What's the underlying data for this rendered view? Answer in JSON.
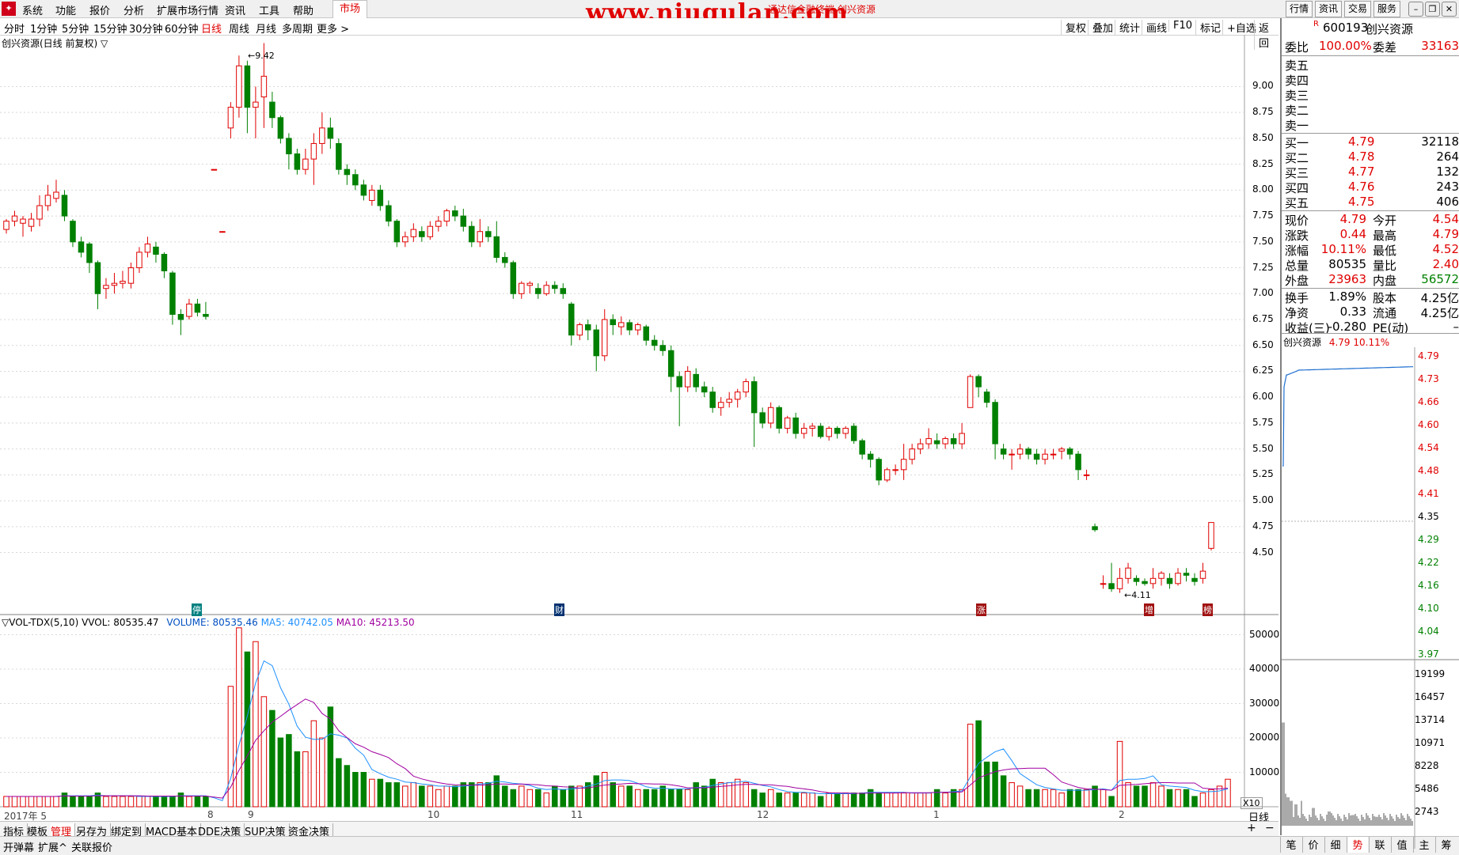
{
  "menu": {
    "items": [
      "系统",
      "功能",
      "报价",
      "分析",
      "扩展市场行情",
      "资讯",
      "工具",
      "帮助"
    ],
    "market": "市场",
    "watermark": "www.niugulan.com",
    "sub_title": "通达信金融终端  创兴资源",
    "right_buttons": [
      "行情",
      "资讯",
      "交易",
      "服务"
    ]
  },
  "periods": [
    "分时",
    "1分钟",
    "5分钟",
    "15分钟",
    "30分钟",
    "60分钟",
    "日线",
    "周线",
    "月线",
    "多周期",
    "更多 >"
  ],
  "active_period": "日线",
  "tools": [
    "复权",
    "叠加",
    "统计",
    "画线",
    "F10",
    "标记",
    "+自选",
    "返回"
  ],
  "chart_title": "创兴资源(日线 前复权) ▽",
  "price_axis": [
    "9.00",
    "8.75",
    "8.50",
    "8.25",
    "8.00",
    "7.75",
    "7.50",
    "7.25",
    "7.00",
    "6.75",
    "6.50",
    "6.25",
    "6.00",
    "5.75",
    "5.50",
    "5.25",
    "5.00",
    "4.75",
    "4.50"
  ],
  "high_marker": "9.42",
  "low_marker": "4.11",
  "event_markers": [
    "停",
    "财",
    "涨",
    "增",
    "榜"
  ],
  "vol_title": {
    "name": "▽VOL-TDX(5,10)",
    "vvol": "VVOL: 80535.47",
    "volume": "VOLUME: 80535.46",
    "ma5": "MA5: 40742.05",
    "ma10": "MA10: 45213.50"
  },
  "vol_axis": [
    "50000",
    "40000",
    "30000",
    "20000",
    "10000"
  ],
  "vol_unit": "X10",
  "date_axis": [
    "2017年 5",
    "8",
    "9",
    "10",
    "11",
    "12",
    "1",
    "2"
  ],
  "bottom_tabs": [
    "指标",
    "模板",
    "管理",
    "另存为",
    "绑定到",
    "MACD基本",
    "DDE决策",
    "SUP决策",
    "资金决策"
  ],
  "status_left": [
    "开弹幕",
    "扩展^",
    "关联报价"
  ],
  "axis_period": "日线",
  "quote": {
    "code_mark": "R",
    "code": "600193",
    "name": "创兴资源",
    "weibi_label": "委比",
    "weibi": "100.00%",
    "weicha_label": "委差",
    "weicha": "33163",
    "sell": [
      {
        "label": "卖五",
        "price": "",
        "vol": ""
      },
      {
        "label": "卖四",
        "price": "",
        "vol": ""
      },
      {
        "label": "卖三",
        "price": "",
        "vol": ""
      },
      {
        "label": "卖二",
        "price": "",
        "vol": ""
      },
      {
        "label": "卖一",
        "price": "",
        "vol": ""
      }
    ],
    "buy": [
      {
        "label": "买一",
        "price": "4.79",
        "vol": "32118"
      },
      {
        "label": "买二",
        "price": "4.78",
        "vol": "264"
      },
      {
        "label": "买三",
        "price": "4.77",
        "vol": "132"
      },
      {
        "label": "买四",
        "price": "4.76",
        "vol": "243"
      },
      {
        "label": "买五",
        "price": "4.75",
        "vol": "406"
      }
    ],
    "stats": [
      {
        "l1": "现价",
        "v1": "4.79",
        "c1": "red",
        "l2": "今开",
        "v2": "4.54",
        "c2": "red"
      },
      {
        "l1": "涨跌",
        "v1": "0.44",
        "c1": "red",
        "l2": "最高",
        "v2": "4.79",
        "c2": "red"
      },
      {
        "l1": "涨幅",
        "v1": "10.11%",
        "c1": "red",
        "l2": "最低",
        "v2": "4.52",
        "c2": "red"
      },
      {
        "l1": "总量",
        "v1": "80535",
        "c1": "black",
        "l2": "量比",
        "v2": "2.40",
        "c2": "red"
      },
      {
        "l1": "外盘",
        "v1": "23963",
        "c1": "red",
        "l2": "内盘",
        "v2": "56572",
        "c2": "green"
      }
    ],
    "stats2": [
      {
        "l1": "换手",
        "v1": "1.89%",
        "l2": "股本",
        "v2": "4.25亿"
      },
      {
        "l1": "净资",
        "v1": "0.33",
        "l2": "流通",
        "v2": "4.25亿"
      },
      {
        "l1": "收益(三)",
        "v1": "-0.280",
        "l2": "PE(动)",
        "v2": "–"
      }
    ],
    "mini_title": "创兴资源",
    "mini_price": "4.79",
    "mini_pct": "10.11%",
    "mini_axis": [
      "4.79",
      "4.73",
      "4.66",
      "4.60",
      "4.54",
      "4.48",
      "4.41",
      "4.35",
      "4.29",
      "4.22",
      "4.16",
      "4.10",
      "4.04",
      "3.97"
    ],
    "mini_vol_axis": [
      "19199",
      "16457",
      "13714",
      "10971",
      "8228",
      "5486",
      "2743"
    ],
    "right_tabs": [
      "笔",
      "价",
      "细",
      "势",
      "联",
      "值",
      "主",
      "筹"
    ]
  },
  "chart_data": {
    "type": "candlestick",
    "ylim": [
      4.0,
      9.5
    ],
    "candles": [
      [
        7.62,
        7.7,
        7.72,
        7.58
      ],
      [
        7.7,
        7.75,
        7.8,
        7.65
      ],
      [
        7.68,
        7.72,
        7.75,
        7.55
      ],
      [
        7.65,
        7.72,
        7.78,
        7.6
      ],
      [
        7.72,
        7.85,
        7.95,
        7.65
      ],
      [
        7.85,
        7.95,
        8.05,
        7.8
      ],
      [
        7.92,
        7.98,
        8.1,
        7.88
      ],
      [
        7.95,
        7.75,
        8.0,
        7.7
      ],
      [
        7.7,
        7.5,
        7.72,
        7.45
      ],
      [
        7.5,
        7.4,
        7.55,
        7.35
      ],
      [
        7.48,
        7.3,
        7.5,
        7.2
      ],
      [
        7.3,
        7.0,
        7.32,
        6.85
      ],
      [
        7.05,
        7.08,
        7.15,
        6.95
      ],
      [
        7.08,
        7.1,
        7.2,
        7.0
      ],
      [
        7.1,
        7.12,
        7.22,
        7.05
      ],
      [
        7.1,
        7.25,
        7.3,
        7.05
      ],
      [
        7.25,
        7.4,
        7.45,
        7.2
      ],
      [
        7.4,
        7.48,
        7.55,
        7.35
      ],
      [
        7.45,
        7.38,
        7.5,
        7.3
      ],
      [
        7.38,
        7.22,
        7.4,
        7.15
      ],
      [
        7.2,
        6.8,
        7.22,
        6.7
      ],
      [
        6.8,
        6.75,
        6.85,
        6.6
      ],
      [
        6.78,
        6.9,
        6.95,
        6.75
      ],
      [
        6.9,
        6.82,
        6.95,
        6.78
      ],
      [
        6.8,
        6.78,
        6.92,
        6.75
      ],
      [
        8.2,
        8.2,
        8.2,
        8.2
      ],
      [
        7.6,
        7.6,
        7.6,
        7.6
      ],
      [
        8.6,
        8.8,
        8.85,
        8.5
      ],
      [
        8.8,
        9.2,
        9.3,
        8.7
      ],
      [
        9.2,
        8.8,
        9.25,
        8.55
      ],
      [
        8.8,
        8.85,
        9.0,
        8.5
      ],
      [
        8.9,
        9.1,
        9.42,
        8.6
      ],
      [
        8.85,
        8.7,
        8.95,
        8.6
      ],
      [
        8.7,
        8.5,
        8.72,
        8.45
      ],
      [
        8.5,
        8.35,
        8.55,
        8.2
      ],
      [
        8.35,
        8.2,
        8.4,
        8.15
      ],
      [
        8.2,
        8.3,
        8.4,
        8.15
      ],
      [
        8.3,
        8.45,
        8.55,
        8.05
      ],
      [
        8.45,
        8.6,
        8.75,
        8.35
      ],
      [
        8.6,
        8.5,
        8.7,
        8.4
      ],
      [
        8.45,
        8.2,
        8.5,
        8.15
      ],
      [
        8.2,
        8.15,
        8.25,
        8.05
      ],
      [
        8.15,
        8.05,
        8.2,
        8.0
      ],
      [
        8.05,
        7.95,
        8.1,
        7.9
      ],
      [
        7.9,
        8.0,
        8.05,
        7.85
      ],
      [
        8.0,
        7.85,
        8.05,
        7.8
      ],
      [
        7.85,
        7.7,
        7.9,
        7.65
      ],
      [
        7.7,
        7.5,
        7.72,
        7.45
      ],
      [
        7.5,
        7.55,
        7.6,
        7.45
      ],
      [
        7.55,
        7.62,
        7.68,
        7.5
      ],
      [
        7.6,
        7.55,
        7.65,
        7.5
      ],
      [
        7.55,
        7.65,
        7.7,
        7.52
      ],
      [
        7.65,
        7.7,
        7.75,
        7.6
      ],
      [
        7.7,
        7.8,
        7.82,
        7.65
      ],
      [
        7.8,
        7.75,
        7.85,
        7.7
      ],
      [
        7.75,
        7.65,
        7.82,
        7.6
      ],
      [
        7.65,
        7.5,
        7.7,
        7.45
      ],
      [
        7.5,
        7.6,
        7.72,
        7.45
      ],
      [
        7.6,
        7.55,
        7.65,
        7.5
      ],
      [
        7.55,
        7.35,
        7.7,
        7.3
      ],
      [
        7.35,
        7.3,
        7.4,
        7.25
      ],
      [
        7.3,
        7.0,
        7.32,
        6.95
      ],
      [
        7.0,
        7.1,
        7.12,
        6.95
      ],
      [
        7.08,
        7.1,
        7.12,
        7.0
      ],
      [
        7.05,
        7.0,
        7.1,
        6.95
      ],
      [
        7.0,
        7.08,
        7.12,
        6.98
      ],
      [
        7.08,
        7.05,
        7.12,
        7.0
      ],
      [
        7.05,
        7.0,
        7.1,
        6.95
      ],
      [
        6.9,
        6.6,
        6.92,
        6.5
      ],
      [
        6.6,
        6.7,
        6.72,
        6.55
      ],
      [
        6.7,
        6.65,
        6.75,
        6.55
      ],
      [
        6.65,
        6.4,
        6.7,
        6.25
      ],
      [
        6.4,
        6.75,
        6.85,
        6.35
      ],
      [
        6.75,
        6.7,
        6.8,
        6.6
      ],
      [
        6.68,
        6.72,
        6.78,
        6.6
      ],
      [
        6.72,
        6.65,
        6.75,
        6.6
      ],
      [
        6.65,
        6.7,
        6.72,
        6.6
      ],
      [
        6.68,
        6.55,
        6.7,
        6.5
      ],
      [
        6.55,
        6.5,
        6.6,
        6.45
      ],
      [
        6.5,
        6.45,
        6.55,
        6.4
      ],
      [
        6.45,
        6.2,
        6.5,
        6.05
      ],
      [
        6.2,
        6.1,
        6.25,
        5.72
      ],
      [
        6.1,
        6.25,
        6.3,
        6.05
      ],
      [
        6.22,
        6.1,
        6.28,
        6.05
      ],
      [
        6.1,
        6.05,
        6.15,
        6.0
      ],
      [
        6.05,
        5.9,
        6.1,
        5.85
      ],
      [
        5.9,
        5.95,
        6.0,
        5.82
      ],
      [
        5.95,
        5.98,
        6.05,
        5.9
      ],
      [
        5.98,
        6.05,
        6.08,
        5.9
      ],
      [
        6.05,
        6.15,
        6.18,
        6.0
      ],
      [
        6.15,
        5.85,
        6.2,
        5.52
      ],
      [
        5.85,
        5.75,
        5.9,
        5.7
      ],
      [
        5.75,
        5.9,
        5.95,
        5.7
      ],
      [
        5.9,
        5.7,
        5.92,
        5.65
      ],
      [
        5.7,
        5.8,
        5.82,
        5.65
      ],
      [
        5.8,
        5.65,
        5.85,
        5.6
      ],
      [
        5.65,
        5.7,
        5.75,
        5.6
      ],
      [
        5.7,
        5.72,
        5.75,
        5.62
      ],
      [
        5.72,
        5.62,
        5.75,
        5.6
      ],
      [
        5.62,
        5.7,
        5.72,
        5.58
      ],
      [
        5.7,
        5.65,
        5.72,
        5.6
      ],
      [
        5.65,
        5.7,
        5.72,
        5.6
      ],
      [
        5.72,
        5.58,
        5.75,
        5.55
      ],
      [
        5.58,
        5.45,
        5.6,
        5.4
      ],
      [
        5.45,
        5.4,
        5.48,
        5.32
      ],
      [
        5.4,
        5.2,
        5.42,
        5.15
      ],
      [
        5.2,
        5.3,
        5.32,
        5.18
      ],
      [
        5.3,
        5.3,
        5.35,
        5.25
      ],
      [
        5.3,
        5.4,
        5.55,
        5.2
      ],
      [
        5.4,
        5.5,
        5.55,
        5.35
      ],
      [
        5.5,
        5.55,
        5.6,
        5.45
      ],
      [
        5.55,
        5.6,
        5.7,
        5.5
      ],
      [
        5.58,
        5.55,
        5.65,
        5.5
      ],
      [
        5.55,
        5.6,
        5.62,
        5.5
      ],
      [
        5.6,
        5.55,
        5.65,
        5.5
      ],
      [
        5.55,
        5.65,
        5.75,
        5.5
      ],
      [
        5.9,
        6.2,
        6.22,
        5.9
      ],
      [
        6.2,
        6.1,
        6.22,
        6.0
      ],
      [
        6.05,
        5.95,
        6.08,
        5.9
      ],
      [
        5.95,
        5.55,
        5.98,
        5.4
      ],
      [
        5.5,
        5.45,
        5.55,
        5.4
      ],
      [
        5.45,
        5.45,
        5.5,
        5.3
      ],
      [
        5.45,
        5.5,
        5.55,
        5.4
      ],
      [
        5.5,
        5.45,
        5.52,
        5.4
      ],
      [
        5.45,
        5.4,
        5.5,
        5.35
      ],
      [
        5.4,
        5.45,
        5.5,
        5.35
      ],
      [
        5.45,
        5.45,
        5.5,
        5.4
      ],
      [
        5.48,
        5.5,
        5.52,
        5.4
      ],
      [
        5.5,
        5.45,
        5.52,
        5.4
      ],
      [
        5.45,
        5.3,
        5.48,
        5.2
      ],
      [
        5.25,
        5.25,
        5.3,
        5.2
      ],
      [
        4.75,
        4.72,
        4.78,
        4.7
      ],
      [
        4.2,
        4.2,
        4.28,
        4.15
      ],
      [
        4.2,
        4.15,
        4.4,
        4.12
      ],
      [
        4.15,
        4.25,
        4.35,
        4.11
      ],
      [
        4.25,
        4.35,
        4.4,
        4.2
      ],
      [
        4.25,
        4.22,
        4.28,
        4.18
      ],
      [
        4.22,
        4.2,
        4.25,
        4.18
      ],
      [
        4.2,
        4.25,
        4.35,
        4.15
      ],
      [
        4.25,
        4.3,
        4.32,
        4.18
      ],
      [
        4.25,
        4.2,
        4.3,
        4.15
      ],
      [
        4.2,
        4.3,
        4.35,
        4.18
      ],
      [
        4.3,
        4.28,
        4.35,
        4.22
      ],
      [
        4.25,
        4.22,
        4.3,
        4.18
      ],
      [
        4.25,
        4.32,
        4.4,
        4.2
      ],
      [
        4.54,
        4.79,
        4.79,
        4.52
      ]
    ],
    "volume": [
      3,
      3,
      3,
      3,
      3,
      3,
      3,
      4,
      3,
      3,
      3,
      4,
      3,
      3,
      3,
      3,
      3,
      3,
      3,
      3,
      3,
      4,
      3,
      3,
      3,
      0,
      0,
      35,
      52,
      45,
      48,
      32,
      28,
      20,
      21,
      16,
      16,
      25,
      20,
      29,
      14,
      12,
      10,
      10,
      8,
      8,
      7,
      7,
      6,
      7,
      6,
      6,
      5,
      6,
      6,
      7,
      7,
      7,
      7,
      9,
      6,
      5,
      6,
      5,
      5,
      4,
      6,
      5,
      6,
      6,
      7,
      9,
      10,
      7,
      6,
      6,
      5,
      5,
      5,
      6,
      5,
      5,
      5,
      7,
      6,
      8,
      7,
      7,
      8,
      7,
      5,
      4,
      5,
      4,
      4,
      4,
      4,
      4,
      3,
      4,
      4,
      4,
      4,
      4,
      5,
      4,
      4,
      4,
      4,
      4,
      4,
      4,
      5,
      4,
      5,
      5,
      24,
      25,
      13,
      13,
      9,
      7,
      6,
      5,
      5,
      5,
      5,
      4,
      5,
      5,
      5,
      6,
      5,
      3,
      19,
      7,
      6,
      6,
      7,
      6,
      5,
      5,
      5,
      3,
      4,
      5,
      6,
      8
    ]
  }
}
